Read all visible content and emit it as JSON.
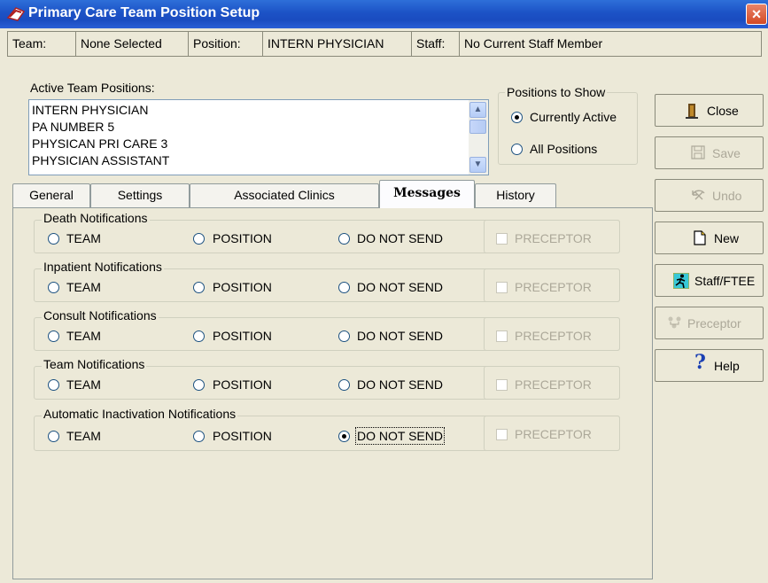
{
  "window": {
    "title": "Primary Care Team Position Setup",
    "close_glyph": "×"
  },
  "infobar": {
    "team_label": "Team:",
    "team_value": "None Selected",
    "position_label": "Position:",
    "position_value": "INTERN PHYSICIAN",
    "staff_label": "Staff:",
    "staff_value": "No Current Staff Member"
  },
  "active_positions": {
    "label": "Active Team Positions:",
    "items": [
      "INTERN PHYSICIAN",
      "PA NUMBER 5",
      "PHYSICAN PRI CARE 3",
      "PHYSICIAN ASSISTANT"
    ]
  },
  "positions_to_show": {
    "label": "Positions to Show",
    "options": [
      {
        "label": "Currently Active",
        "selected": true
      },
      {
        "label": "All Positions",
        "selected": false
      }
    ]
  },
  "tabs": [
    {
      "label": "General",
      "active": false
    },
    {
      "label": "Settings",
      "active": false
    },
    {
      "label": "Associated Clinics",
      "active": false
    },
    {
      "label": "Messages",
      "active": true
    },
    {
      "label": "History",
      "active": false
    }
  ],
  "notification_groups": [
    {
      "title": "Death Notifications",
      "selected": null
    },
    {
      "title": "Inpatient Notifications",
      "selected": null
    },
    {
      "title": "Consult Notifications",
      "selected": null
    },
    {
      "title": "Team Notifications",
      "selected": null
    },
    {
      "title": "Automatic Inactivation  Notifications",
      "selected": "DO NOT SEND"
    }
  ],
  "notification_options": {
    "team": "TEAM",
    "position": "POSITION",
    "do_not_send": "DO NOT SEND",
    "preceptor": "PRECEPTOR"
  },
  "buttons": {
    "close": "Close",
    "save": "Save",
    "undo": "Undo",
    "new": "New",
    "staff_ftee": "Staff/FTEE",
    "preceptor": "Preceptor",
    "help": "Help"
  },
  "icons": {
    "app": "team-setup-icon",
    "close": "door-exit-icon",
    "save": "floppy-disk-icon",
    "undo": "undo-icon",
    "new": "new-document-icon",
    "staff": "running-person-icon",
    "preceptor": "people-tree-icon",
    "help": "question-mark-icon"
  },
  "colors": {
    "titlebar": "#1c52c6",
    "radio_selected": "#21a121",
    "disabled_text": "#aca899",
    "help_icon": "#1a3fb3"
  }
}
